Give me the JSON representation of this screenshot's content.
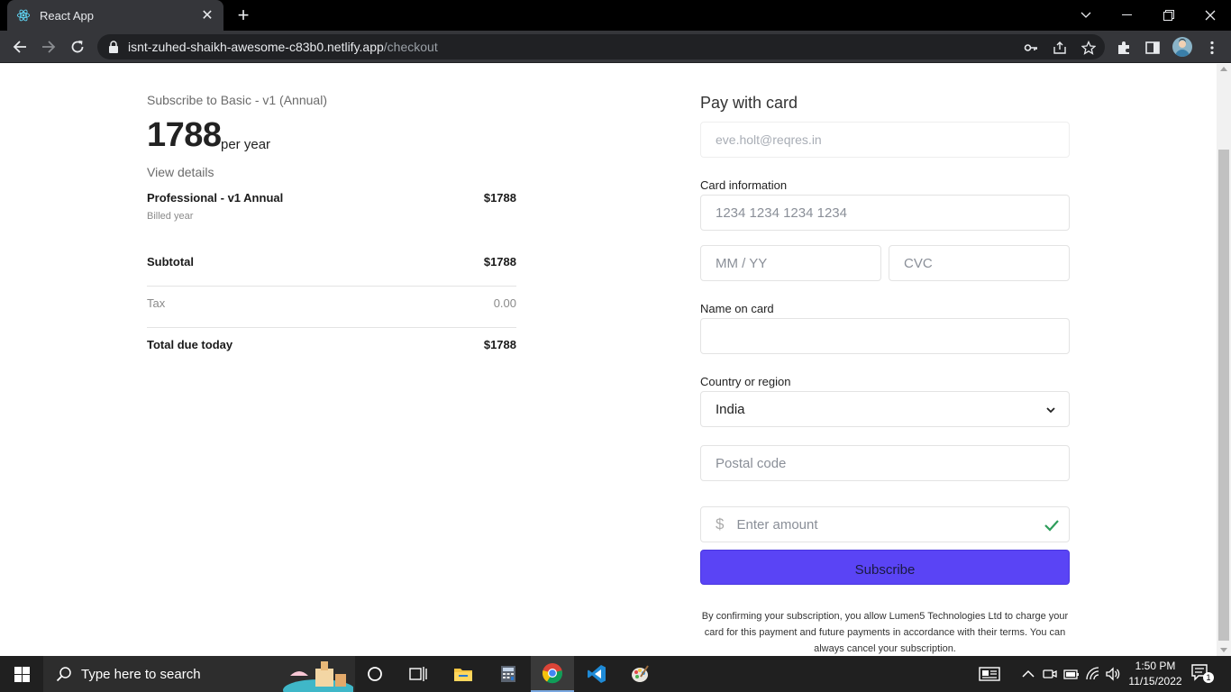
{
  "browser": {
    "tab_title": "React App",
    "url_host": "isnt-zuhed-shaikh-awesome-c83b0.netlify.app",
    "url_path": "/checkout"
  },
  "summary": {
    "subscribe_to": "Subscribe to Basic - v1 (Annual)",
    "price": "1788",
    "price_unit": "per year",
    "view_details": "View details",
    "item_name": "Professional - v1 Annual",
    "item_price": "$1788",
    "item_billing": "Billed year",
    "subtotal_label": "Subtotal",
    "subtotal_value": "$1788",
    "tax_label": "Tax",
    "tax_value": "0.00",
    "total_label": "Total due today",
    "total_value": "$1788"
  },
  "form": {
    "title": "Pay with card",
    "email_placeholder": "eve.holt@reqres.in",
    "card_label": "Card information",
    "card_number_placeholder": "1234 1234 1234 1234",
    "expiry_placeholder": "MM / YY",
    "cvc_placeholder": "CVC",
    "name_label": "Name on card",
    "name_value": "",
    "country_label": "Country or region",
    "country_value": "India",
    "postal_placeholder": "Postal code",
    "currency_symbol": "$",
    "amount_placeholder": "Enter amount",
    "subscribe_label": "Subscribe",
    "terms": "By confirming your subscription, you allow Lumen5 Technologies Ltd to charge your card for this payment and future payments in accordance with their terms. You can always cancel your subscription."
  },
  "taskbar": {
    "search_placeholder": "Type here to search",
    "time": "1:50 PM",
    "date": "11/15/2022",
    "notification_count": "1"
  },
  "colors": {
    "accent": "#5a44f5",
    "success_check": "#2e9d5b",
    "chrome_dark": "#35363a"
  },
  "icons": [
    "react-icon",
    "close-icon",
    "plus-icon",
    "back-icon",
    "forward-icon",
    "reload-icon",
    "lock-icon",
    "key-icon",
    "share-icon",
    "star-icon",
    "extensions-icon",
    "sidepanel-icon",
    "menu-icon",
    "chevron-down-icon",
    "checkmark-icon",
    "windows-icon",
    "search-icon",
    "cortana-icon",
    "taskview-icon",
    "file-explorer-icon",
    "calculator-icon",
    "chrome-icon",
    "vscode-icon",
    "paint-icon"
  ]
}
